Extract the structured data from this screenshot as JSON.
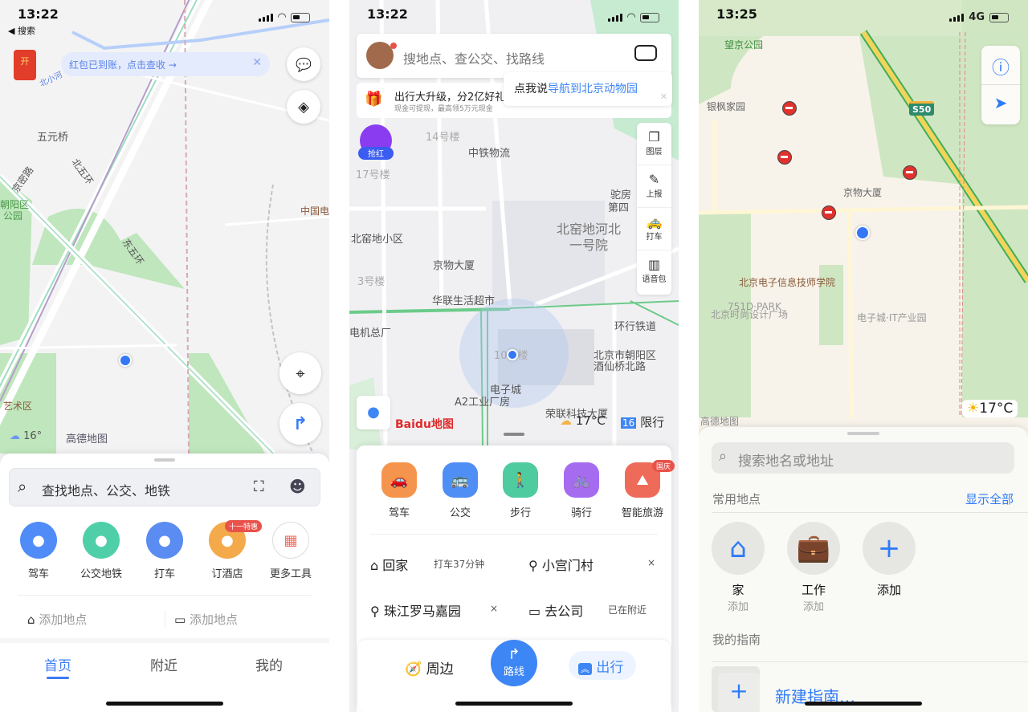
{
  "amap": {
    "status": {
      "time": "13:22",
      "back": "◀ 搜索"
    },
    "banner": {
      "text": "红包已到账，点击查收 →",
      "envelope_glyph": "开"
    },
    "map_labels": [
      "五元桥",
      "北小河",
      "京密路",
      "北五环",
      "东五环",
      "朝阳区",
      "公园",
      "中国电",
      "艺术区",
      "高德地图"
    ],
    "weather": {
      "temp": "16°",
      "icon": "cloud-icon"
    },
    "search": {
      "placeholder": "查找地点、公交、地铁"
    },
    "tools": [
      {
        "label": "驾车",
        "color": "#4f8cf7"
      },
      {
        "label": "公交地铁",
        "color": "#4fcfa8"
      },
      {
        "label": "打车",
        "color": "#5a8cf2"
      },
      {
        "label": "订酒店",
        "color": "#f4a94a",
        "badge": "十一特惠"
      },
      {
        "label": "更多工具",
        "color": "#ffffff"
      }
    ],
    "places": [
      "添加地点",
      "添加地点"
    ],
    "tabs": [
      {
        "label": "首页",
        "active": true
      },
      {
        "label": "附近"
      },
      {
        "label": "我的"
      }
    ],
    "accent": "#3b7cf5"
  },
  "baidu": {
    "status": {
      "time": "13:22"
    },
    "search": {
      "placeholder": "搜地点、查公交、找路线"
    },
    "promo": {
      "title": "出行大升级，分2亿好礼",
      "subtitle": "现金可提现，最高领5万元现金"
    },
    "tooltip": {
      "prefix": "点我说",
      "link": "导航到北京动物园"
    },
    "red_packet": "抢红",
    "side_tools": [
      "图层",
      "上报",
      "打车",
      "语音包"
    ],
    "map_labels": [
      "14号楼",
      "中铁物流",
      "17号楼",
      "驼房",
      "第四",
      "北窑地河北",
      "一号院",
      "北窑地小区",
      "京物大厦",
      "3号楼",
      "华联生活超市",
      "电机总厂",
      "环行铁道",
      "北京市朝阳区",
      "酒仙桥北路",
      "10号楼",
      "电子城",
      "A2工业厂房",
      "荣联科技大厦"
    ],
    "logo": "Baidu地图",
    "weather": {
      "temp": "17°C",
      "icon": "cloudy-sun-icon"
    },
    "restriction": {
      "numbers": "16",
      "label": "限行"
    },
    "modes": [
      {
        "label": "驾车",
        "color": "#f5954d"
      },
      {
        "label": "公交",
        "color": "#4f8ef5"
      },
      {
        "label": "步行",
        "color": "#4fcba0"
      },
      {
        "label": "骑行",
        "color": "#a56cf0"
      },
      {
        "label": "智能旅游",
        "color": "#ee6b5a",
        "badge": "国庆"
      }
    ],
    "shortcuts": [
      {
        "icon": "home-icon",
        "label": "回家",
        "info": "打车37分钟"
      },
      {
        "icon": "pin-icon",
        "label": "小宫门村",
        "info": "×"
      },
      {
        "icon": "pin-icon",
        "label": "珠江罗马嘉园",
        "info": "×"
      },
      {
        "icon": "briefcase-icon",
        "label": "去公司",
        "info": "已在附近"
      }
    ],
    "bottom": {
      "nearby": "周边",
      "route": "路线",
      "travel": "出行"
    },
    "accent": "#3d86f5"
  },
  "apple": {
    "status": {
      "time": "13:25",
      "network": "4G"
    },
    "map_labels": [
      "望京公园",
      "银枫家园",
      "京物大厦",
      "北京电子信息技师学院",
      "751D·PARK",
      "北京时尚设计广场",
      "电子城·IT产业园",
      "高德地图"
    ],
    "highway": "S50",
    "weather": {
      "temp": "17°C",
      "icon": "sun-icon"
    },
    "search": {
      "placeholder": "搜索地名或地址"
    },
    "favorites": {
      "title": "常用地点",
      "show_all": "显示全部",
      "items": [
        {
          "label": "家",
          "sub": "添加",
          "icon": "house-icon"
        },
        {
          "label": "工作",
          "sub": "添加",
          "icon": "briefcase-icon"
        },
        {
          "label": "添加",
          "icon": "plus-icon"
        }
      ]
    },
    "guides": {
      "title": "我的指南",
      "new": "新建指南…"
    },
    "accent": "#2f7bf6"
  }
}
